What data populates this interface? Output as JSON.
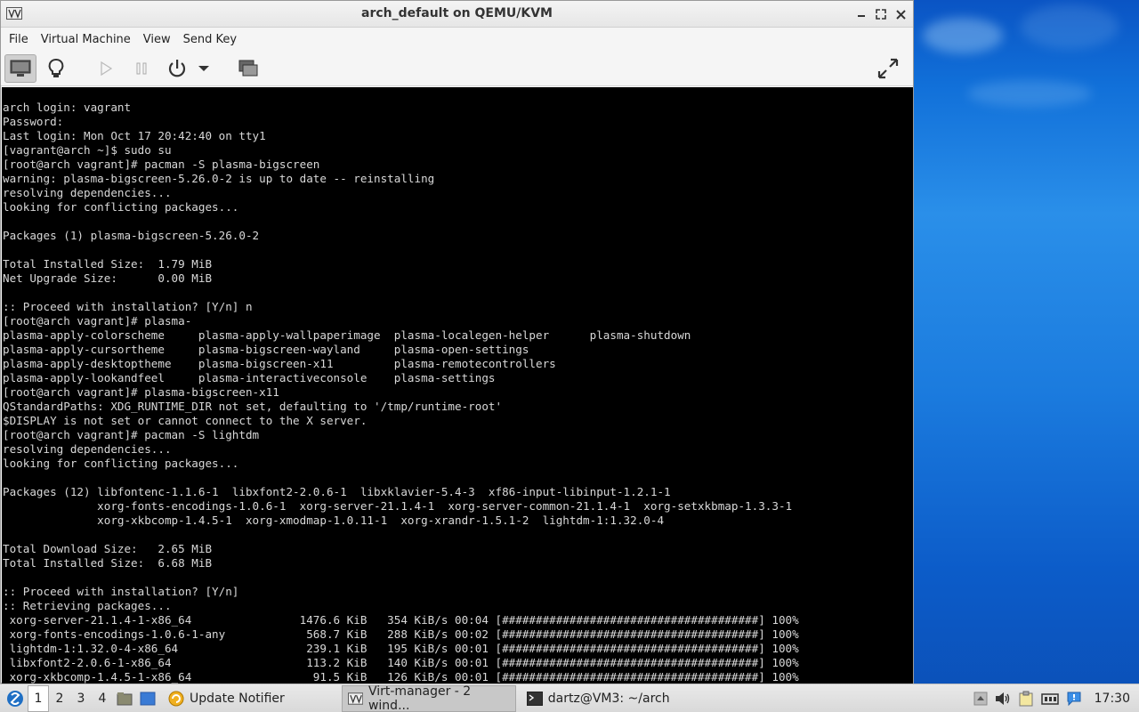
{
  "window": {
    "title": "arch_default on QEMU/KVM",
    "controls": [
      "minimize",
      "maximize",
      "close"
    ]
  },
  "menubar": {
    "items": [
      "File",
      "Virtual Machine",
      "View",
      "Send Key"
    ]
  },
  "toolbar": {
    "buttons": [
      "console-icon",
      "lightbulb-icon",
      "play-icon",
      "pause-icon",
      "power-icon",
      "chevron-down-icon",
      "screenshot-icon",
      "fullscreen-icon"
    ]
  },
  "terminal": {
    "lines": [
      "arch login: vagrant",
      "Password:",
      "Last login: Mon Oct 17 20:42:40 on tty1",
      "[vagrant@arch ~]$ sudo su",
      "[root@arch vagrant]# pacman -S plasma-bigscreen",
      "warning: plasma-bigscreen-5.26.0-2 is up to date -- reinstalling",
      "resolving dependencies...",
      "looking for conflicting packages...",
      "",
      "Packages (1) plasma-bigscreen-5.26.0-2",
      "",
      "Total Installed Size:  1.79 MiB",
      "Net Upgrade Size:      0.00 MiB",
      "",
      ":: Proceed with installation? [Y/n] n",
      "[root@arch vagrant]# plasma-",
      "plasma-apply-colorscheme     plasma-apply-wallpaperimage  plasma-localegen-helper      plasma-shutdown",
      "plasma-apply-cursortheme     plasma-bigscreen-wayland     plasma-open-settings",
      "plasma-apply-desktoptheme    plasma-bigscreen-x11         plasma-remotecontrollers",
      "plasma-apply-lookandfeel     plasma-interactiveconsole    plasma-settings",
      "[root@arch vagrant]# plasma-bigscreen-x11",
      "QStandardPaths: XDG_RUNTIME_DIR not set, defaulting to '/tmp/runtime-root'",
      "$DISPLAY is not set or cannot connect to the X server.",
      "[root@arch vagrant]# pacman -S lightdm",
      "resolving dependencies...",
      "looking for conflicting packages...",
      "",
      "Packages (12) libfontenc-1.1.6-1  libxfont2-2.0.6-1  libxklavier-5.4-3  xf86-input-libinput-1.2.1-1",
      "              xorg-fonts-encodings-1.0.6-1  xorg-server-21.1.4-1  xorg-server-common-21.1.4-1  xorg-setxkbmap-1.3.3-1",
      "              xorg-xkbcomp-1.4.5-1  xorg-xmodmap-1.0.11-1  xorg-xrandr-1.5.1-2  lightdm-1:1.32.0-4",
      "",
      "Total Download Size:   2.65 MiB",
      "Total Installed Size:  6.68 MiB",
      "",
      ":: Proceed with installation? [Y/n]",
      ":: Retrieving packages...",
      " xorg-server-21.1.4-1-x86_64                1476.6 KiB   354 KiB/s 00:04 [######################################] 100%",
      " xorg-fonts-encodings-1.0.6-1-any            568.7 KiB   288 KiB/s 00:02 [######################################] 100%",
      " lightdm-1:1.32.0-4-x86_64                   239.1 KiB   195 KiB/s 00:01 [######################################] 100%",
      " libxfont2-2.0.6-1-x86_64                    113.2 KiB   140 KiB/s 00:01 [######################################] 100%",
      " xorg-xkbcomp-1.4.5-1-x86_64                  91.5 KiB   126 KiB/s 00:01 [######################################] 100%"
    ]
  },
  "taskbar": {
    "workspaces": [
      "1",
      "2",
      "3",
      "4"
    ],
    "tasks": [
      {
        "label": "Update Notifier",
        "icon": "update-notifier-icon"
      },
      {
        "label": "Virt-manager - 2 wind...",
        "icon": "virt-manager-icon"
      },
      {
        "label": "dartz@VM3: ~/arch",
        "icon": "terminal-icon"
      }
    ],
    "clock": "17:30"
  }
}
